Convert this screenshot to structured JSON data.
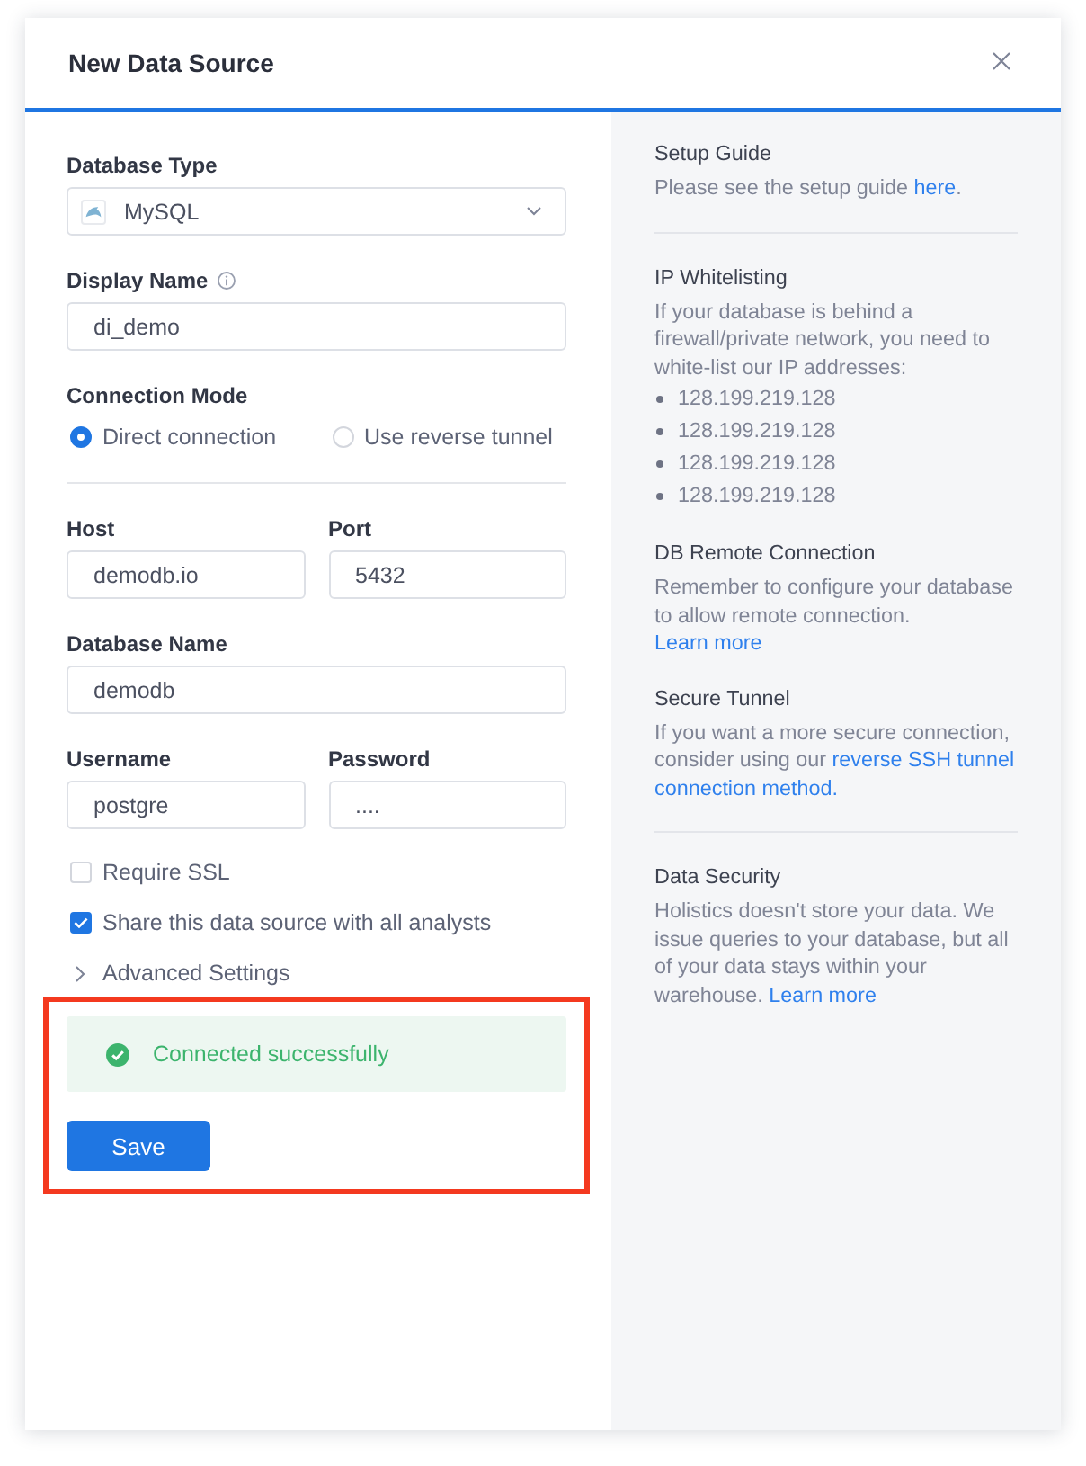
{
  "dialog": {
    "title": "New Data Source"
  },
  "form": [
    {
      "kind": "fields",
      "fields": [
        {
          "kind": "select",
          "label": "Database Type",
          "value": "MySQL"
        }
      ]
    },
    {
      "kind": "fields",
      "fields": [
        {
          "kind": "text",
          "label": "Display Name",
          "value": "di_demo",
          "info": true
        }
      ]
    },
    {
      "kind": "radio_group",
      "label": "Connection Mode",
      "options": [
        {
          "label": "Direct connection",
          "selected": true
        },
        {
          "label": "Use reverse tunnel",
          "selected": false
        }
      ],
      "divider_after": true
    },
    {
      "kind": "fields",
      "fields": [
        {
          "kind": "text",
          "label": "Host",
          "value": "demodb.io"
        },
        {
          "kind": "text",
          "label": "Port",
          "value": "5432"
        }
      ]
    },
    {
      "kind": "fields",
      "fields": [
        {
          "kind": "text",
          "label": "Database Name",
          "value": "demodb"
        }
      ]
    },
    {
      "kind": "fields",
      "fields": [
        {
          "kind": "text",
          "label": "Username",
          "value": "postgre"
        },
        {
          "kind": "password",
          "label": "Password",
          "value": "...."
        }
      ]
    },
    {
      "kind": "checkbox",
      "label": "Require SSL",
      "checked": false
    },
    {
      "kind": "checkbox",
      "label": "Share this data source with all analysts",
      "checked": true
    },
    {
      "kind": "expander",
      "label": "Advanced Settings",
      "expanded": false
    }
  ],
  "result": {
    "highlighted": true,
    "status": {
      "kind": "success",
      "message": "Connected successfully"
    },
    "save_button": "Save"
  },
  "guide": [
    {
      "title": "Setup Guide",
      "text": [
        {
          "text": "Please see the setup guide "
        },
        {
          "link": "here"
        },
        {
          "text": "."
        }
      ],
      "divider_after": true
    },
    {
      "title": "IP Whitelisting",
      "text": [
        {
          "text": "If your database is behind a firewall/private network, you need to white-list our IP addresses:"
        }
      ],
      "ip_addresses": [
        "128.199.219.128",
        "128.199.219.128",
        "128.199.219.128",
        "128.199.219.128"
      ]
    },
    {
      "title": "DB Remote Connection",
      "text": [
        {
          "text": "Remember to configure your database to allow remote connection."
        }
      ],
      "link": "Learn more"
    },
    {
      "title": "Secure Tunnel",
      "text": [
        {
          "text": "If you want a more secure connection, consider using our "
        },
        {
          "link": "reverse SSH tunnel "
        },
        {
          "link": "connection method."
        }
      ],
      "divider_after": true
    },
    {
      "title": "Data Security",
      "text": [
        {
          "text": "Holistics doesn't store your data. We issue queries to your database, but all of your data stays within your warehouse. "
        },
        {
          "link": "Learn more"
        }
      ]
    }
  ]
}
